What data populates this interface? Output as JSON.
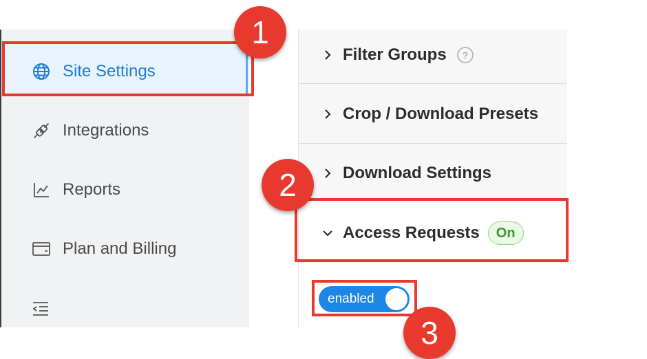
{
  "sidebar": {
    "items": [
      {
        "label": "Site Settings",
        "icon": "globe-icon",
        "active": true
      },
      {
        "label": "Integrations",
        "icon": "plug-icon",
        "active": false
      },
      {
        "label": "Reports",
        "icon": "chart-icon",
        "active": false
      },
      {
        "label": "Plan and Billing",
        "icon": "wallet-icon",
        "active": false
      }
    ],
    "collapse_icon": "collapse-sidebar-icon"
  },
  "panel": {
    "sections": [
      {
        "label": "Filter Groups",
        "expanded": false,
        "has_help": true
      },
      {
        "label": "Crop / Download Presets",
        "expanded": false
      },
      {
        "label": "Download Settings",
        "expanded": false
      },
      {
        "label": "Access Requests",
        "expanded": true,
        "badge": "On"
      }
    ],
    "toggle": {
      "label": "enabled",
      "state": "on"
    }
  },
  "markers": [
    "1",
    "2",
    "3"
  ],
  "colors": {
    "accent": "#1c7ed6",
    "highlight": "#e8392f",
    "badge_green": "#3e9a2a",
    "toggle_blue": "#1c87e6"
  }
}
